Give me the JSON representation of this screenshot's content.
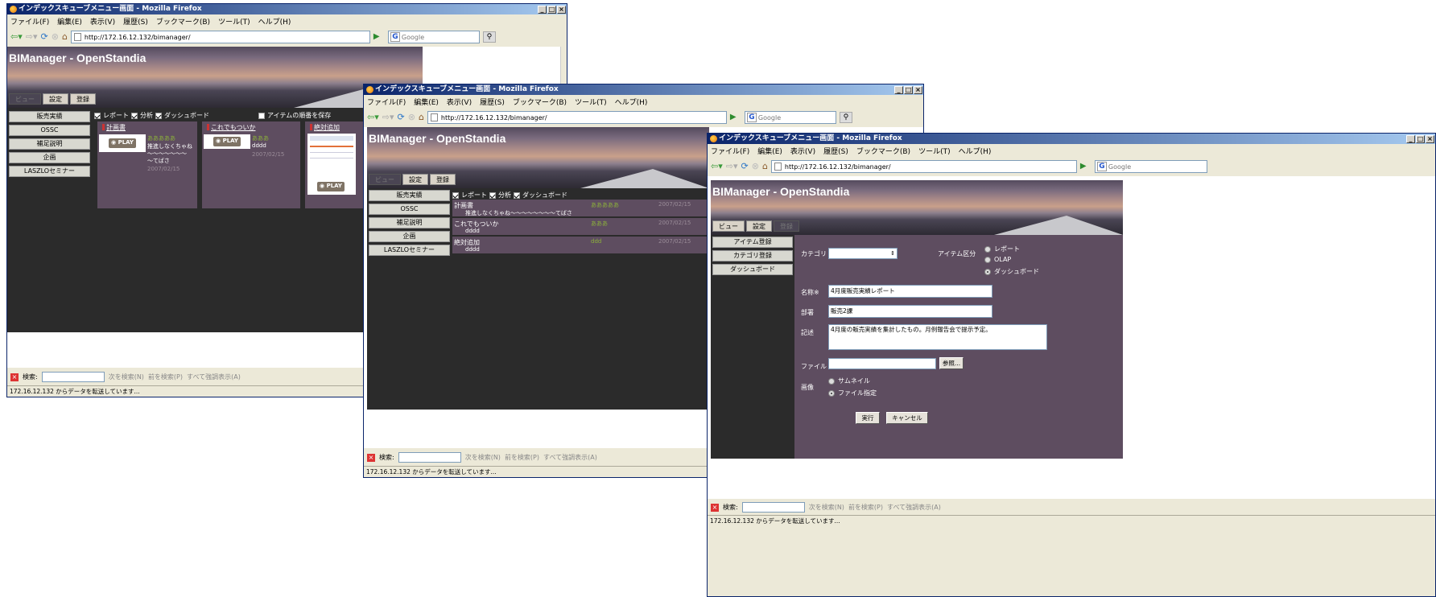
{
  "window_title": "インデックスキューブメニュー画面 - Mozilla Firefox",
  "window_buttons": [
    "_",
    "□",
    "×"
  ],
  "menu": [
    "ファイル(F)",
    "編集(E)",
    "表示(V)",
    "履歴(S)",
    "ブックマーク(B)",
    "ツール(T)",
    "ヘルプ(H)"
  ],
  "url": "http://172.16.12.132/bimanager/",
  "search_engine": "Google",
  "app_title": "BIManager - OpenStandia",
  "tabs": {
    "view": "ビュー",
    "settings": "設定",
    "register": "登録"
  },
  "categories": [
    "販売実績",
    "OSSC",
    "補足説明",
    "企画",
    "LASZLOセミナー"
  ],
  "filters": {
    "report": "レポート",
    "analysis": "分析",
    "dashboard": "ダッシュボード",
    "save_order": "アイテムの順番を保存"
  },
  "items": [
    {
      "title": "計画書",
      "author": "あああああ",
      "desc": "推進しなくちゃね～～～～～～～～てばさ",
      "desc_wrapped": [
        "推進しなくちゃね",
        "～～～～～～～",
        "～てばさ"
      ],
      "date": "2007/02/15"
    },
    {
      "title": "これでもついか",
      "author": "あああ",
      "desc": "dddd",
      "date": "2007/02/15"
    },
    {
      "title": "絶対追加",
      "author": "ddd",
      "desc": "dddd",
      "date": "2007/02/15"
    }
  ],
  "play_label": "PLAY",
  "findbar": {
    "close": "×",
    "label": "検索:",
    "next": "次を検索(N)",
    "prev": "前を検索(P)",
    "highlight": "すべて強調表示(A)"
  },
  "status_text": "172.16.12.132 からデータを転送しています...",
  "settings_menu": [
    "アイテム登録",
    "カテゴリ登録",
    "ダッシュボード"
  ],
  "form": {
    "category_label": "カテゴリ",
    "item_type_label": "アイテム区分",
    "item_types": [
      "レポート",
      "OLAP",
      "ダッシュボード"
    ],
    "name_label": "名称※",
    "name_value": "4月度販売実績レポート",
    "dept_label": "部署",
    "dept_value": "販売2課",
    "desc_label": "記述",
    "desc_value": "4月度の販売実績を集計したもの。月例報告会で提示予定。",
    "file_label": "ファイル",
    "browse_button": "参照...",
    "image_label": "画像",
    "image_options": [
      "サムネイル",
      "ファイル指定"
    ],
    "submit_button": "実行",
    "cancel_button": "キャンセル"
  }
}
